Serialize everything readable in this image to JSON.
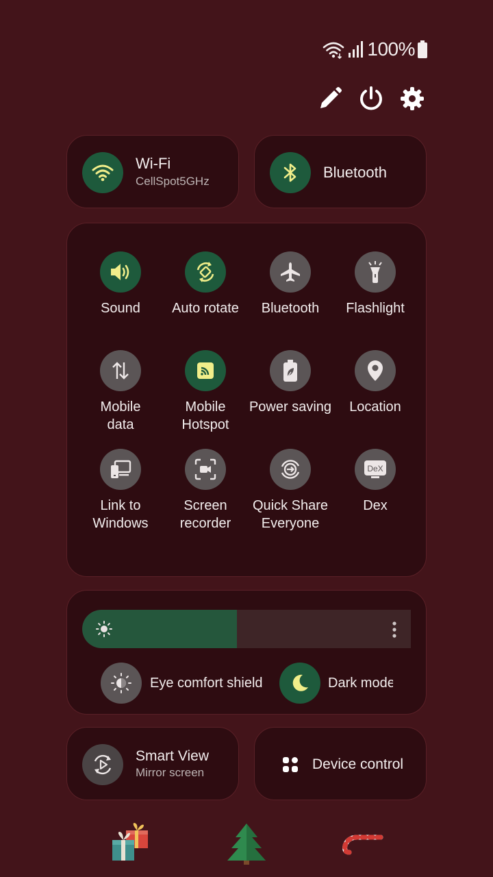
{
  "status_bar": {
    "battery_percent": "100%",
    "icons": [
      "wifi-icon",
      "signal-icon",
      "battery-icon"
    ]
  },
  "top_actions": [
    "edit-icon",
    "power-icon",
    "settings-icon"
  ],
  "wifi": {
    "title": "Wi-Fi",
    "subtitle": "CellSpot5GHz",
    "state": "on"
  },
  "bluetooth_big": {
    "title": "Bluetooth",
    "state": "on"
  },
  "tiles": [
    {
      "label": "Sound",
      "icon": "sound-icon",
      "state": "on"
    },
    {
      "label": "Auto rotate",
      "icon": "auto-rotate-icon",
      "state": "on"
    },
    {
      "label": "Bluetooth",
      "icon": "airplane-icon",
      "state": "off"
    },
    {
      "label": "Flashlight",
      "icon": "flashlight-icon",
      "state": "off"
    },
    {
      "label": "Mobile data",
      "line1": "Mobile",
      "line2": "data",
      "icon": "mobile-data-icon",
      "state": "off"
    },
    {
      "label": "Mobile Hotspot",
      "line1": "Mobile",
      "line2": "Hotspot",
      "icon": "hotspot-icon",
      "state": "on"
    },
    {
      "label": "Power saving",
      "icon": "power-saving-icon",
      "state": "off"
    },
    {
      "label": "Location",
      "icon": "location-icon",
      "state": "off"
    },
    {
      "label": "Link to Windows",
      "line1": "Link to",
      "line2": "Windows",
      "icon": "link-to-windows-icon",
      "state": "off"
    },
    {
      "label": "Screen recorder",
      "line1": "Screen",
      "line2": "recorder",
      "icon": "screen-recorder-icon",
      "state": "off"
    },
    {
      "label": "Quick Share Everyone",
      "line1": "Quick Share",
      "line2": "Everyone",
      "icon": "quick-share-icon",
      "state": "off"
    },
    {
      "label": "Dex",
      "icon": "dex-icon",
      "state": "off",
      "icon_text": "DeX"
    }
  ],
  "page_indicator": {
    "pages": 2,
    "current": 1
  },
  "brightness": {
    "level": 0.47
  },
  "eye_comfort": {
    "label": "Eye comfort shield",
    "state": "off"
  },
  "dark_mode": {
    "label": "Dark mode",
    "state": "on"
  },
  "smart_view": {
    "title": "Smart View",
    "subtitle": "Mirror screen"
  },
  "device_control": {
    "label": "Device control"
  },
  "decorations": [
    "gifts-icon",
    "christmas-tree-icon",
    "candy-cane-icon"
  ],
  "colors": {
    "background": "#43141a",
    "panel": "#2e0c11",
    "active": "#1e5a3c",
    "inactive": "#5b5556",
    "active_glyph": "#f1ee8a"
  }
}
